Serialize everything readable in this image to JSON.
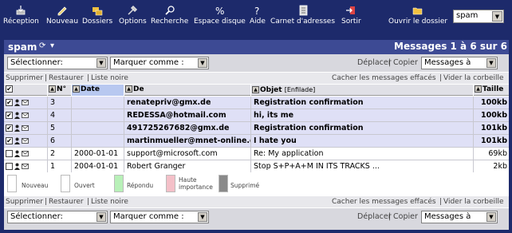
{
  "toolbar": {
    "items": [
      {
        "label": "Réception",
        "icon": "inbox-icon"
      },
      {
        "label": "Nouveau",
        "icon": "compose-icon"
      },
      {
        "label": "Dossiers",
        "icon": "folders-icon"
      },
      {
        "label": "Options",
        "icon": "options-icon"
      },
      {
        "label": "Recherche",
        "icon": "search-icon"
      },
      {
        "label": "Espace disque",
        "icon": "disk-space-icon"
      },
      {
        "label": "Aide",
        "icon": "help-icon"
      },
      {
        "label": "Carnet d'adresses",
        "icon": "address-book-icon"
      },
      {
        "label": "Sortir",
        "icon": "logout-icon"
      }
    ],
    "open_folder": "Ouvrir le dossier",
    "folder_select": "spam"
  },
  "folder": {
    "name": "spam",
    "message_count": "Messages 1 à 6 sur 6"
  },
  "controls": {
    "select_label": "Sélectionner:",
    "mark_label": "Marquer comme :",
    "move": "Déplacer",
    "copy": "Copier",
    "target_select": "Messages à"
  },
  "links": {
    "delete": "Supprimer",
    "restore": "Restaurer",
    "blacklist": "Liste noire",
    "hide_deleted": "Cacher les messages effacés",
    "empty_trash": "Vider la corbeille"
  },
  "columns": {
    "number": "N°",
    "date": "Date",
    "from": "De",
    "subject": "Objet",
    "threaded": "[Enfilade]",
    "size": "Taille"
  },
  "messages": [
    {
      "n": "3",
      "date": "",
      "from": "renatepriv@gmx.de",
      "subject": "Registration confirmation",
      "size": "100kb",
      "checked": "✔",
      "unread": true
    },
    {
      "n": "4",
      "date": "",
      "from": "REDESSA@hotmail.com",
      "subject": "hi, its me",
      "size": "100kb",
      "checked": "✔",
      "unread": true
    },
    {
      "n": "5",
      "date": "",
      "from": "491725267682@gmx.de",
      "subject": "Registration confirmation",
      "size": "101kb",
      "checked": "✔",
      "unread": true
    },
    {
      "n": "6",
      "date": "",
      "from": "martinmueller@mnet-online.de",
      "subject": "I hate you",
      "size": "101kb",
      "checked": "✔",
      "unread": true
    },
    {
      "n": "2",
      "date": "2000-01-01",
      "from": "support@microsoft.com",
      "subject": "Re: My application",
      "size": "69kb",
      "checked": "",
      "unread": false
    },
    {
      "n": "1",
      "date": "2004-01-01",
      "from": "Robert Granger",
      "subject": "Stop S+P+A+M IN ITS TRACKS ...",
      "size": "2kb",
      "checked": "",
      "unread": false
    }
  ],
  "legend": [
    {
      "label": "Nouveau",
      "color": "#ffffff"
    },
    {
      "label": "Ouvert",
      "color": "#ffffff"
    },
    {
      "label": "Répondu",
      "color": "#b8f0b8"
    },
    {
      "label": "Haute importance",
      "color": "#f4c0c8"
    },
    {
      "label": "Supprimé",
      "color": "#8a8a8a"
    }
  ],
  "colors": {
    "background": "#1d2a6b",
    "titlebar": "#3d4a94",
    "unread_row": "#dfe0f6"
  }
}
